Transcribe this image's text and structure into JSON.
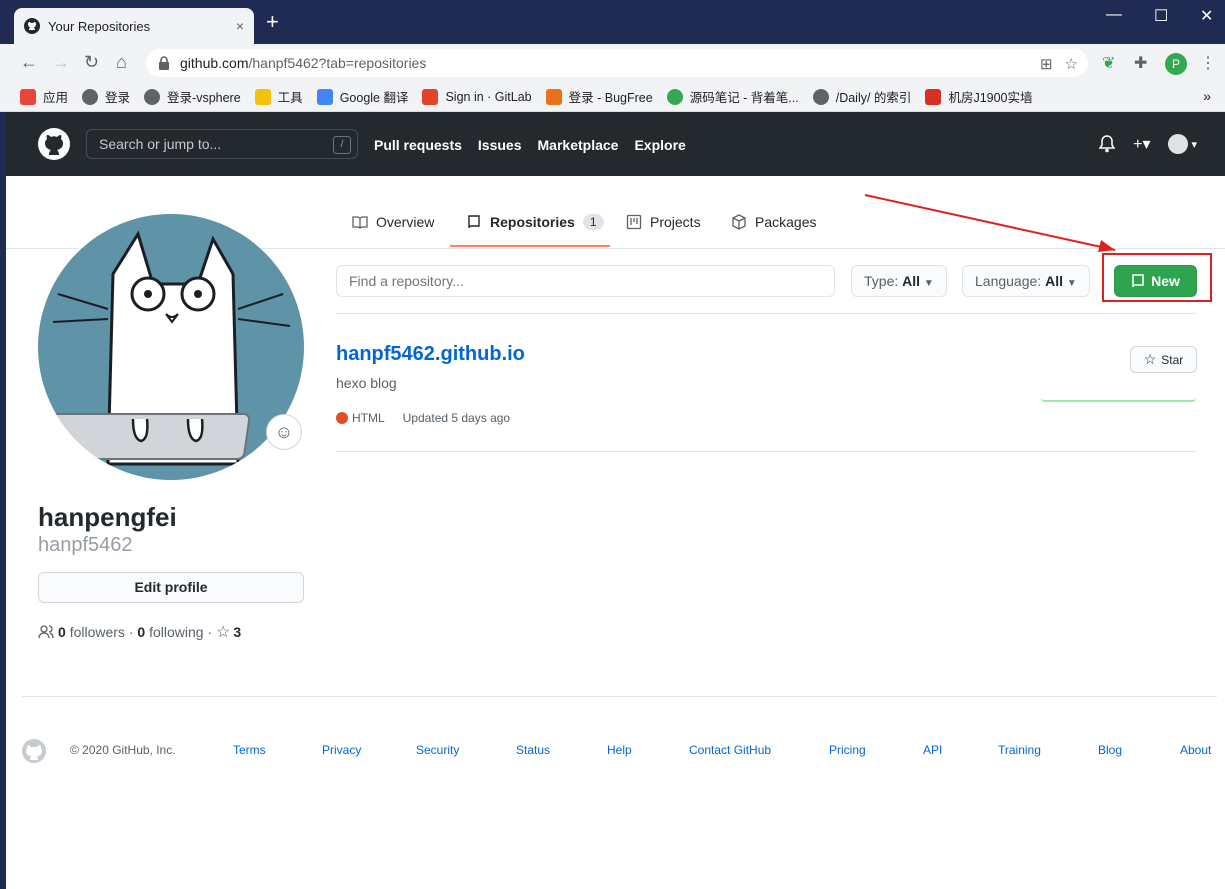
{
  "browser": {
    "tab_title": "Your Repositories",
    "tab_close": "×",
    "new_tab": "+",
    "url_host": "github.com",
    "url_path": "/hanpf5462?tab=repositories",
    "profile_letter": "P",
    "window_controls": {
      "minimize": "—",
      "maximize": "☐",
      "close": "✕"
    },
    "bookmarks": [
      {
        "label": "应用",
        "color": "#e8453c"
      },
      {
        "label": "登录",
        "color": "#5f6368"
      },
      {
        "label": "登录-vsphere",
        "color": "#5f6368"
      },
      {
        "label": "工具",
        "color": "#f4c20d"
      },
      {
        "label": "Google 翻译",
        "color": "#4285f4"
      },
      {
        "label": "Sign in · GitLab",
        "color": "#e24329"
      },
      {
        "label": "登录 - BugFree",
        "color": "#e8711a"
      },
      {
        "label": "源码笔记 - 背着笔...",
        "color": "#34a853"
      },
      {
        "label": "/Daily/ 的索引",
        "color": "#5f6368"
      },
      {
        "label": "机房J1900实墙",
        "color": "#d93025"
      }
    ],
    "bookmarks_more": "»"
  },
  "header": {
    "search_placeholder": "Search or jump to...",
    "search_shortcut": "/",
    "nav": [
      "Pull requests",
      "Issues",
      "Marketplace",
      "Explore"
    ],
    "plus": "+▾",
    "avatar_caret": "▾"
  },
  "tabs": [
    {
      "label": "Overview",
      "icon": "book-icon"
    },
    {
      "label": "Repositories",
      "icon": "repo-icon",
      "count": "1"
    },
    {
      "label": "Projects",
      "icon": "project-icon"
    },
    {
      "label": "Packages",
      "icon": "package-icon"
    }
  ],
  "profile": {
    "name": "hanpengfei",
    "login": "hanpf5462",
    "edit_label": "Edit profile",
    "followers_count": "0",
    "followers_label": "followers",
    "following_count": "0",
    "following_label": "following",
    "stars_count": "3",
    "separator": "·"
  },
  "filters": {
    "find_placeholder": "Find a repository...",
    "type_label": "Type:",
    "type_value": "All",
    "language_label": "Language:",
    "language_value": "All",
    "new_label": "New"
  },
  "repo": {
    "name": "hanpf5462.github.io",
    "description": "hexo blog",
    "language": "HTML",
    "language_color": "#e34c26",
    "updated": "Updated 5 days ago",
    "star_label": "Star"
  },
  "footer": {
    "copyright": "© 2020 GitHub, Inc.",
    "links": [
      "Terms",
      "Privacy",
      "Security",
      "Status",
      "Help",
      "Contact GitHub",
      "Pricing",
      "API",
      "Training",
      "Blog",
      "About"
    ]
  },
  "colors": {
    "accent_green": "#2ea44f",
    "link_blue": "#0366d6",
    "header_dark": "#24292e",
    "annotation_red": "#e02020"
  }
}
